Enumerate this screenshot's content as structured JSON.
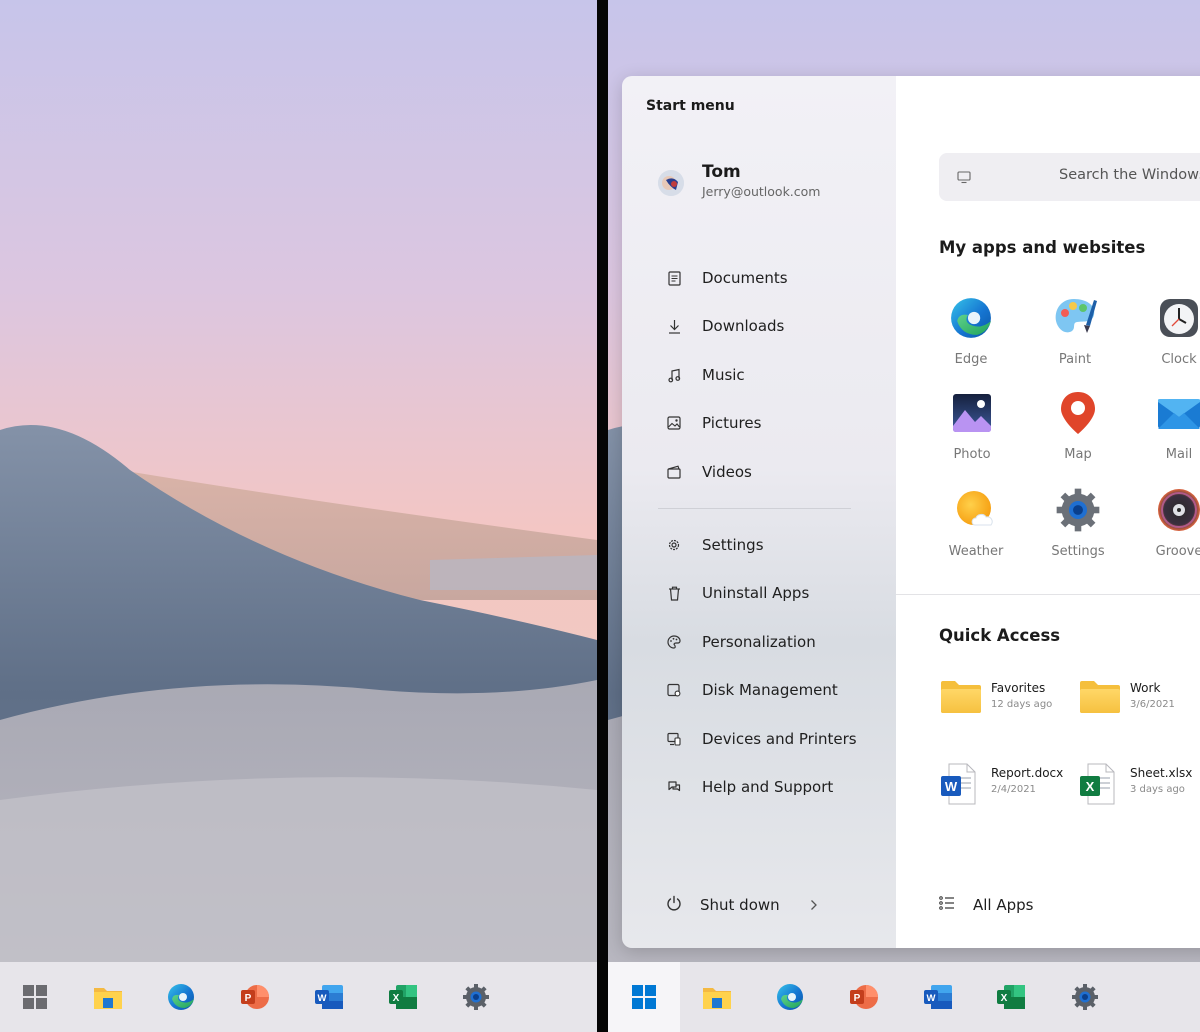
{
  "start_menu": {
    "title": "Start menu",
    "user": {
      "name": "Tom",
      "email": "Jerry@outlook.com"
    },
    "folders": [
      {
        "label": "Documents",
        "icon": "document-icon"
      },
      {
        "label": "Downloads",
        "icon": "download-icon"
      },
      {
        "label": "Music",
        "icon": "music-icon"
      },
      {
        "label": "Pictures",
        "icon": "pictures-icon"
      },
      {
        "label": "Videos",
        "icon": "videos-icon"
      }
    ],
    "system": [
      {
        "label": "Settings",
        "icon": "gear-icon"
      },
      {
        "label": "Uninstall Apps",
        "icon": "trash-icon"
      },
      {
        "label": "Personalization",
        "icon": "palette-icon"
      },
      {
        "label": "Disk Management",
        "icon": "disk-icon"
      },
      {
        "label": "Devices and Printers",
        "icon": "devices-icon"
      },
      {
        "label": "Help and Support",
        "icon": "help-icon"
      }
    ],
    "shutdown_label": "Shut down",
    "search_placeholder": "Search the Windows",
    "apps_title": "My apps and websites",
    "apps": [
      {
        "label": "Edge",
        "icon": "edge-icon"
      },
      {
        "label": "Paint",
        "icon": "paint-icon"
      },
      {
        "label": "Clock",
        "icon": "clock-icon"
      },
      {
        "label": "Photo",
        "icon": "photo-icon"
      },
      {
        "label": "Map",
        "icon": "map-icon"
      },
      {
        "label": "Mail",
        "icon": "mail-icon"
      },
      {
        "label": "Weather",
        "icon": "weather-icon"
      },
      {
        "label": "Settings",
        "icon": "settings-icon"
      },
      {
        "label": "Groove",
        "icon": "groove-icon"
      }
    ],
    "quick_access_title": "Quick Access",
    "quick_access": [
      {
        "name": "Favorites",
        "date": "12 days ago",
        "icon": "folder-icon"
      },
      {
        "name": "Work",
        "date": "3/6/2021",
        "icon": "folder-icon"
      },
      {
        "name": "Report.docx",
        "date": "2/4/2021",
        "icon": "word-file-icon"
      },
      {
        "name": "Sheet.xlsx",
        "date": "3 days ago",
        "icon": "excel-file-icon"
      }
    ],
    "all_apps_label": "All Apps"
  },
  "taskbar": {
    "items": [
      "windows-start-icon",
      "file-explorer-icon",
      "edge-icon",
      "powerpoint-icon",
      "word-icon",
      "excel-icon",
      "settings-icon"
    ]
  },
  "colors": {
    "taskbar": "#e7e5ea",
    "start_left": "#eceaf0",
    "accent_blue": "#0078d4"
  }
}
